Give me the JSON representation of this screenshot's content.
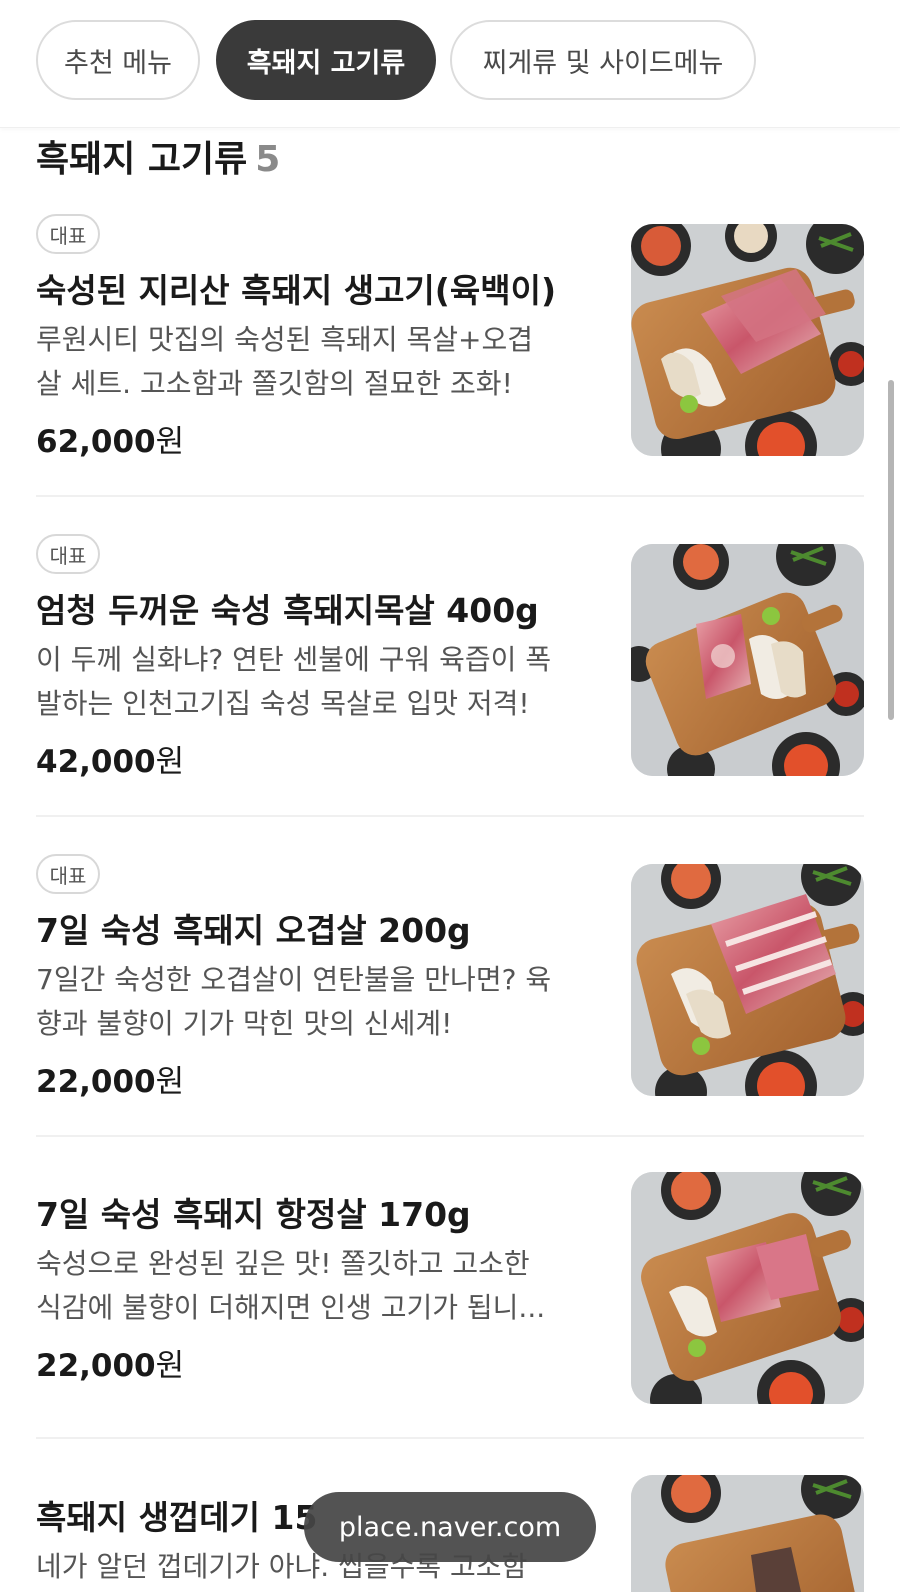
{
  "tabs": [
    {
      "label": "추천 메뉴",
      "active": false
    },
    {
      "label": "흑돼지 고기류",
      "active": true
    },
    {
      "label": "찌게류 및 사이드메뉴",
      "active": false
    }
  ],
  "section": {
    "title": "흑돼지 고기류",
    "count": "5"
  },
  "items": [
    {
      "badge": "대표",
      "name": "숙성된 지리산 흑돼지 생고기(육백이)",
      "desc_lines": [
        "루원시티 맛집의 숙성된 흑돼지 목살+오겹",
        "살 세트. 고소함과 쫄깃함의 절묘한 조화!"
      ],
      "price": "62,000",
      "currency": "원",
      "image": "pork-platter-photo"
    },
    {
      "badge": "대표",
      "name": "엄청 두꺼운 숙성 흑돼지목살 400g",
      "desc_lines": [
        "이 두께 실화냐? 연탄 센불에 구워 육즙이 폭",
        "발하는 인천고기집 숙성 목살로 입맛 저격!"
      ],
      "price": "42,000",
      "currency": "원",
      "image": "pork-neck-photo"
    },
    {
      "badge": "대표",
      "name": "7일 숙성 흑돼지 오겹살 200g",
      "desc_lines": [
        "7일간 숙성한 오겹살이 연탄불을 만나면? 육",
        "향과 불향이 기가 막힌 맛의 신세계!"
      ],
      "price": "22,000",
      "currency": "원",
      "image": "pork-belly-photo"
    },
    {
      "badge": "",
      "name": "7일 숙성 흑돼지 항정살 170g",
      "desc_lines": [
        "숙성으로 완성된 깊은 맛! 쫄깃하고 고소한",
        "식감에 불향이 더해지면 인생 고기가 됩니..."
      ],
      "price": "22,000",
      "currency": "원",
      "image": "pork-jowl-photo"
    },
    {
      "badge": "",
      "name": "흑돼지 생껍데기 15",
      "desc_lines": [
        "네가 알던 껍데기가 아냐. 씹을수록 고소함"
      ],
      "price": "",
      "currency": "",
      "image": "pork-skin-photo"
    }
  ],
  "toast": {
    "text": "place.naver.com"
  }
}
